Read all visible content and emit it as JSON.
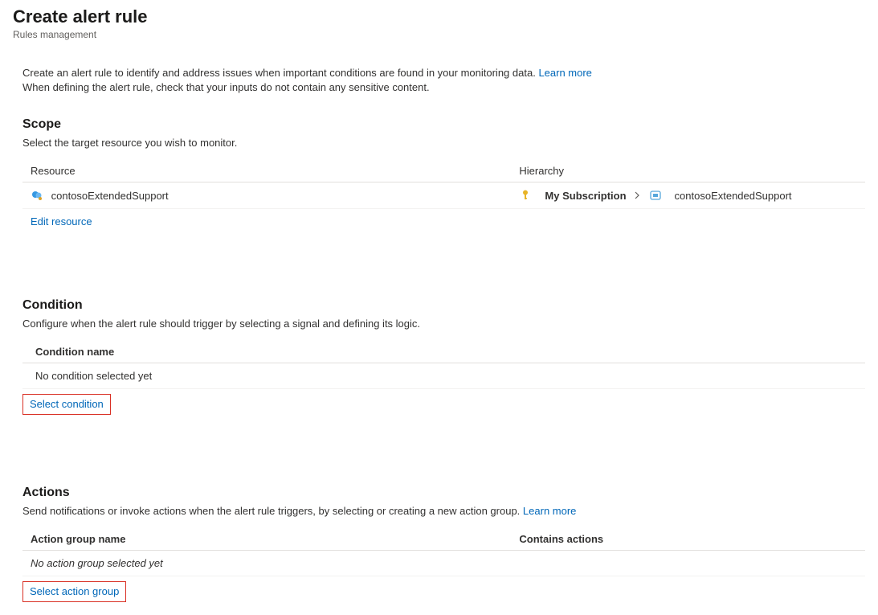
{
  "header": {
    "title": "Create alert rule",
    "subtitle": "Rules management"
  },
  "intro": {
    "line1": "Create an alert rule to identify and address issues when important conditions are found in your monitoring data.",
    "learn_more": "Learn more",
    "line2": "When defining the alert rule, check that your inputs do not contain any sensitive content."
  },
  "scope": {
    "title": "Scope",
    "desc": "Select the target resource you wish to monitor.",
    "col_resource": "Resource",
    "col_hierarchy": "Hierarchy",
    "resource_name": "contosoExtendedSupport",
    "subscription": "My Subscription",
    "resource_group": "contosoExtendedSupport",
    "edit_link": "Edit resource"
  },
  "condition": {
    "title": "Condition",
    "desc": "Configure when the alert rule should trigger by selecting a signal and defining its logic.",
    "col_name": "Condition name",
    "empty": "No condition selected yet",
    "select_link": "Select condition"
  },
  "actions": {
    "title": "Actions",
    "desc": "Send notifications or invoke actions when the alert rule triggers, by selecting or creating a new action group.",
    "learn_more": "Learn more",
    "col_name": "Action group name",
    "col_contains": "Contains actions",
    "empty": "No action group selected yet",
    "select_link": "Select action group"
  }
}
